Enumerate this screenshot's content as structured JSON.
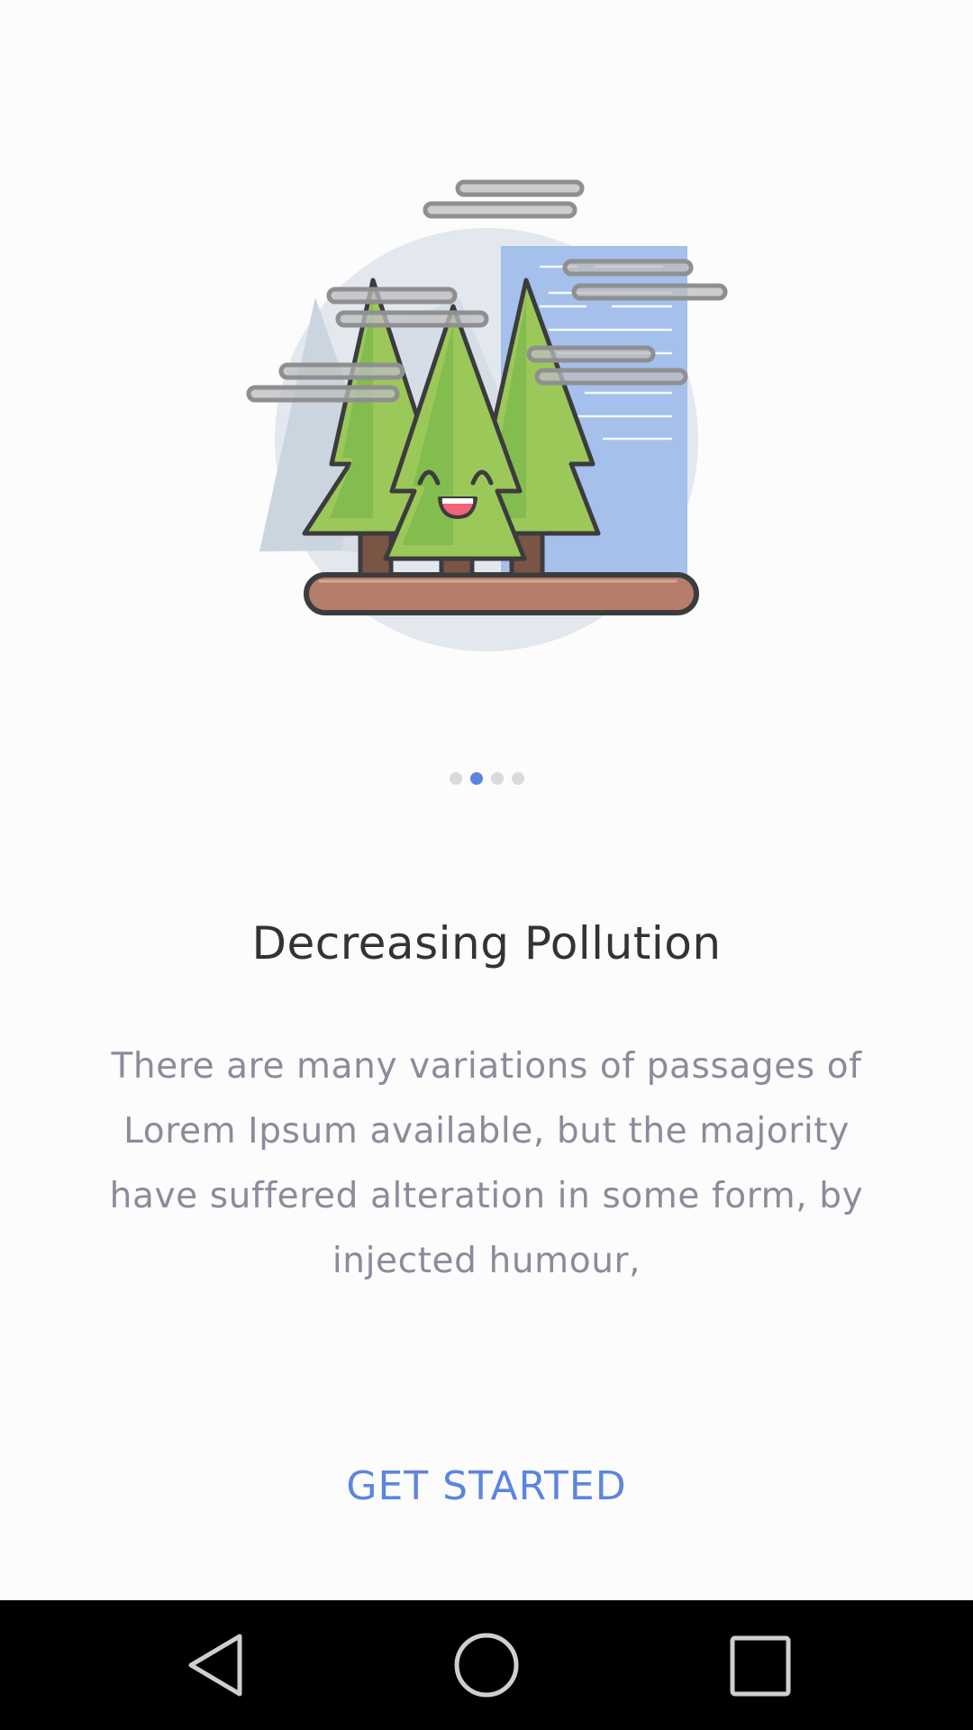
{
  "onboarding": {
    "pager": {
      "total_pages": 4,
      "current_page": 2
    },
    "title": "Decreasing Pollution",
    "description": "There are many variations of passages of Lorem Ipsum available, but the majority have suffered alteration in some form, by injected humour,",
    "cta_label": "GET STARTED"
  },
  "system_nav": {
    "buttons": [
      "back",
      "home",
      "recents"
    ]
  },
  "colors": {
    "accent": "#5b86df",
    "title": "#333336",
    "body_text": "#8a8c9a",
    "background": "#fcfcfd",
    "dot_inactive": "#d9dade",
    "tree_green": "#9cc85a",
    "building_blue": "#a4c0eb",
    "ground_brown": "#b57e6a",
    "smog_gray": "#c4c4c6"
  },
  "icons": {
    "illustration": "happy-trees-city-smog-illustration",
    "back": "back-triangle-icon",
    "home": "home-circle-icon",
    "recents": "recents-square-icon"
  }
}
